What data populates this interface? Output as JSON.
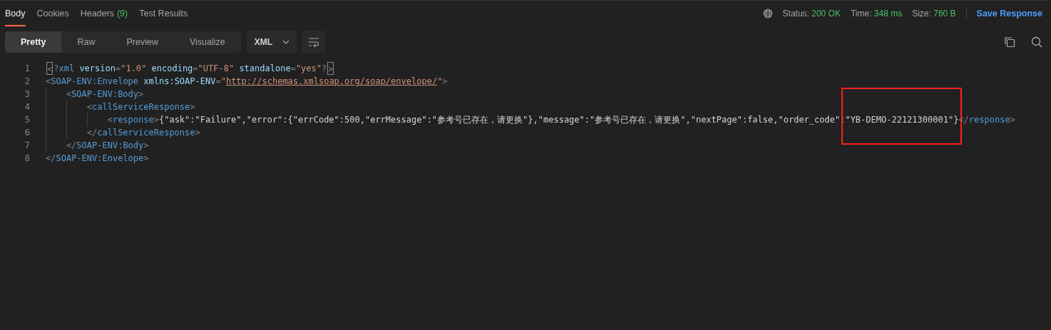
{
  "tabs": [
    {
      "label": "Body",
      "selected": true
    },
    {
      "label": "Cookies",
      "selected": false
    },
    {
      "label": "Headers",
      "count": "(9)",
      "selected": false
    },
    {
      "label": "Test Results",
      "selected": false
    }
  ],
  "status": [
    {
      "label": "Status:",
      "value": "200 OK"
    },
    {
      "label": "Time:",
      "value": "348 ms"
    },
    {
      "label": "Size:",
      "value": "760 B"
    }
  ],
  "save_button": "Save Response",
  "view_modes": [
    {
      "label": "Pretty",
      "selected": true
    },
    {
      "label": "Raw",
      "selected": false
    },
    {
      "label": "Preview",
      "selected": false
    },
    {
      "label": "Visualize",
      "selected": false
    }
  ],
  "format_dropdown": "XML",
  "code_lines": [
    {
      "number": "1",
      "tokens": [
        {
          "kind": "bracket",
          "text": "<"
        },
        {
          "kind": "punct",
          "text": "?"
        },
        {
          "kind": "tag",
          "text": "xml"
        },
        {
          "kind": "attr",
          "text": " version"
        },
        {
          "kind": "punct",
          "text": "="
        },
        {
          "kind": "string",
          "text": "\"1.0\""
        },
        {
          "kind": "attr",
          "text": " encoding"
        },
        {
          "kind": "punct",
          "text": "="
        },
        {
          "kind": "string",
          "text": "\"UTF-8\""
        },
        {
          "kind": "attr",
          "text": " standalone"
        },
        {
          "kind": "punct",
          "text": "="
        },
        {
          "kind": "string",
          "text": "\"yes\""
        },
        {
          "kind": "punct",
          "text": "?"
        },
        {
          "kind": "bracket",
          "text": ">"
        }
      ]
    },
    {
      "number": "2",
      "tokens": [
        {
          "kind": "punct",
          "text": "<"
        },
        {
          "kind": "tag",
          "text": "SOAP-ENV:Envelope"
        },
        {
          "kind": "attr",
          "text": " xmlns:SOAP-ENV"
        },
        {
          "kind": "punct",
          "text": "="
        },
        {
          "kind": "string",
          "text": "\""
        },
        {
          "kind": "link",
          "text": "http://schemas.xmlsoap.org/soap/envelope/"
        },
        {
          "kind": "string",
          "text": "\""
        },
        {
          "kind": "punct",
          "text": ">"
        }
      ]
    },
    {
      "number": "3",
      "tokens": [
        {
          "kind": "punct",
          "text": "    <"
        },
        {
          "kind": "tag",
          "text": "SOAP-ENV:Body"
        },
        {
          "kind": "punct",
          "text": ">"
        }
      ]
    },
    {
      "number": "4",
      "tokens": [
        {
          "kind": "punct",
          "text": "        <"
        },
        {
          "kind": "tag",
          "text": "callServiceResponse"
        },
        {
          "kind": "punct",
          "text": ">"
        }
      ]
    },
    {
      "number": "5",
      "tokens": [
        {
          "kind": "punct",
          "text": "            <"
        },
        {
          "kind": "tag",
          "text": "response"
        },
        {
          "kind": "punct",
          "text": ">"
        },
        {
          "kind": "text",
          "text": "{\"ask\":\"Failure\",\"error\":{\"errCode\":500,\"errMessage\":\"参考号已存在，请更换\"},\"message\":\"参考号已存在，请更换\",\"nextPage\":false,\"order_code\":"
        },
        {
          "kind": "text",
          "text": "\"YB-DEMO-22121300001\"}",
          "highlighted": true
        },
        {
          "kind": "punct",
          "text": "</"
        },
        {
          "kind": "tag",
          "text": "response"
        },
        {
          "kind": "punct",
          "text": ">"
        }
      ]
    },
    {
      "number": "6",
      "tokens": [
        {
          "kind": "punct",
          "text": "        </"
        },
        {
          "kind": "tag",
          "text": "callServiceResponse"
        },
        {
          "kind": "punct",
          "text": ">"
        }
      ]
    },
    {
      "number": "7",
      "tokens": [
        {
          "kind": "punct",
          "text": "    </"
        },
        {
          "kind": "tag",
          "text": "SOAP-ENV:Body"
        },
        {
          "kind": "punct",
          "text": ">"
        }
      ]
    },
    {
      "number": "8",
      "tokens": [
        {
          "kind": "punct",
          "text": "</"
        },
        {
          "kind": "tag",
          "text": "SOAP-ENV:Envelope"
        },
        {
          "kind": "punct",
          "text": ">"
        }
      ]
    }
  ]
}
